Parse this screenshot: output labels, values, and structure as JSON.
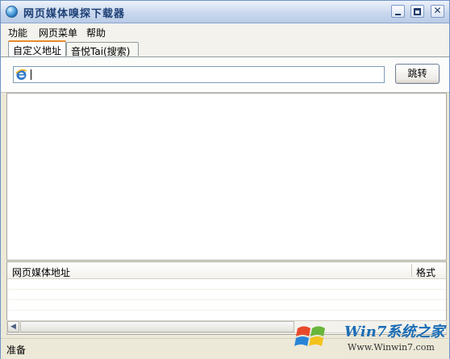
{
  "window": {
    "title": "网页媒体嗅探下载器"
  },
  "menu": [
    "功能",
    "网页菜单",
    "帮助"
  ],
  "tabs": [
    "自定义地址",
    "音悦Tai(搜索)"
  ],
  "address": {
    "value": "",
    "go_label": "跳转"
  },
  "media_list": {
    "columns": [
      "网页媒体地址",
      "格式"
    ]
  },
  "status": {
    "text": "准备"
  },
  "watermark": {
    "site": "Win7系统之家",
    "url": "Www.Winwin7.com"
  }
}
